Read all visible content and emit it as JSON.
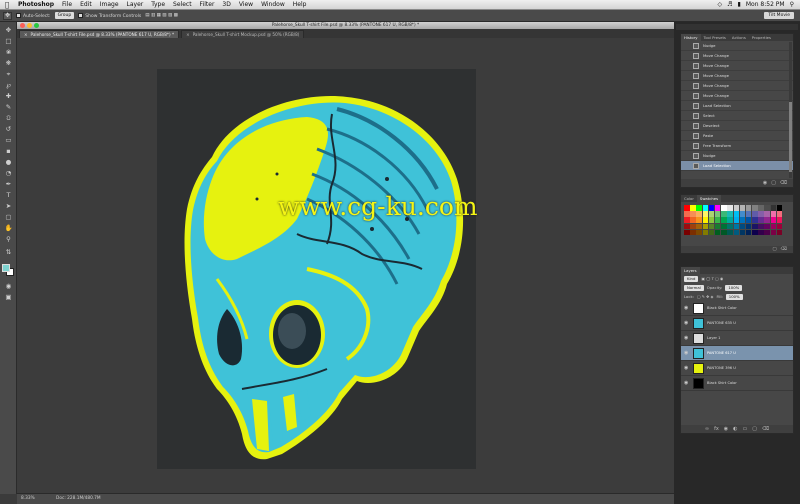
{
  "menubar": {
    "apple": "",
    "items": [
      "Photoshop",
      "File",
      "Edit",
      "Image",
      "Layer",
      "Type",
      "Select",
      "Filter",
      "3D",
      "View",
      "Window",
      "Help"
    ],
    "clock": "Mon 8:52 PM"
  },
  "options": {
    "auto_select": "Auto-Select:",
    "group": "Group",
    "show_transform": "Show Transform Controls",
    "workspace": "Tilt Movie"
  },
  "document": {
    "title": "Palehorse_Skull T-shirt File.psd @ 8.33% (PANTONE 617 U, RGB/8*) *",
    "tabs": [
      {
        "label": "Palehorse_Skull T-shirt File.psd @ 8.33% (PANTONE 617 U, RGB/8*) *"
      },
      {
        "label": "Palehorse_Skull T-shirt Mockup.psd @ 50% (RGB/8)"
      }
    ],
    "watermark": "www.cg-ku.com"
  },
  "status": {
    "zoom": "8.33%",
    "doc": "Doc: 228.1M/480.7M"
  },
  "history": {
    "tabs": [
      "History",
      "Tool Presets",
      "Actions",
      "Properties"
    ],
    "items": [
      "Nudge",
      "Move Change",
      "Move Change",
      "Move Change",
      "Move Change",
      "Move Change",
      "Load Selection",
      "Select",
      "Deselect",
      "Paste",
      "Free Transform",
      "Nudge",
      "Load Selection"
    ],
    "active_index": 12
  },
  "swatches": {
    "tabs": [
      "Color",
      "Swatches"
    ],
    "colors": [
      "#ff0000",
      "#ffff00",
      "#00ff00",
      "#00ffff",
      "#0000ff",
      "#ff00ff",
      "#ffffff",
      "#e6e6e6",
      "#cccccc",
      "#b3b3b3",
      "#999999",
      "#808080",
      "#666666",
      "#4d4d4d",
      "#333333",
      "#000000",
      "#f26c4f",
      "#f68e55",
      "#fbaf5c",
      "#fff467",
      "#acd372",
      "#7cc576",
      "#3bb878",
      "#1abbb4",
      "#00bff3",
      "#438ccb",
      "#5574b9",
      "#605ca8",
      "#855fa8",
      "#a763a8",
      "#f06ea9",
      "#f26d7d",
      "#ed1c24",
      "#f26522",
      "#f7941d",
      "#fff200",
      "#8dc63f",
      "#39b54a",
      "#00a651",
      "#00a99d",
      "#00aeef",
      "#0072bc",
      "#0054a6",
      "#2e3192",
      "#662d91",
      "#92278f",
      "#ec008c",
      "#ed145b",
      "#9e0b0f",
      "#a0410d",
      "#a36209",
      "#aba000",
      "#598527",
      "#1a7b30",
      "#007236",
      "#00746b",
      "#0076a3",
      "#004b80",
      "#003471",
      "#1b1464",
      "#440e62",
      "#630460",
      "#9e005d",
      "#9e0039",
      "#790000",
      "#7b2e00",
      "#7d4900",
      "#827b00",
      "#406618",
      "#005e20",
      "#005826",
      "#005952",
      "#005b7f",
      "#003663",
      "#002157",
      "#0d004c",
      "#32004b",
      "#4b0049",
      "#7b0046",
      "#7a0026"
    ]
  },
  "layers": {
    "tabs": [
      "Layers"
    ],
    "kind": "Kind",
    "blend": "Normal",
    "opacity_label": "Opacity:",
    "opacity": "100%",
    "lock_label": "Lock:",
    "fill_label": "Fill:",
    "fill": "100%",
    "items": [
      {
        "name": "Black Shirt Color"
      },
      {
        "name": "PANTONE 635 U"
      },
      {
        "name": "Layer 1"
      },
      {
        "name": "PANTONE 617 U"
      },
      {
        "name": "PANTONE 396 U"
      },
      {
        "name": "Black Shirt Color"
      }
    ],
    "active_index": 3
  },
  "colors": {
    "foreground": "#7dd3d0",
    "background": "#ffffff",
    "skull_cyan": "#3fc2d8",
    "skull_yellow": "#e6f20f",
    "selection": "#7a93ad"
  }
}
